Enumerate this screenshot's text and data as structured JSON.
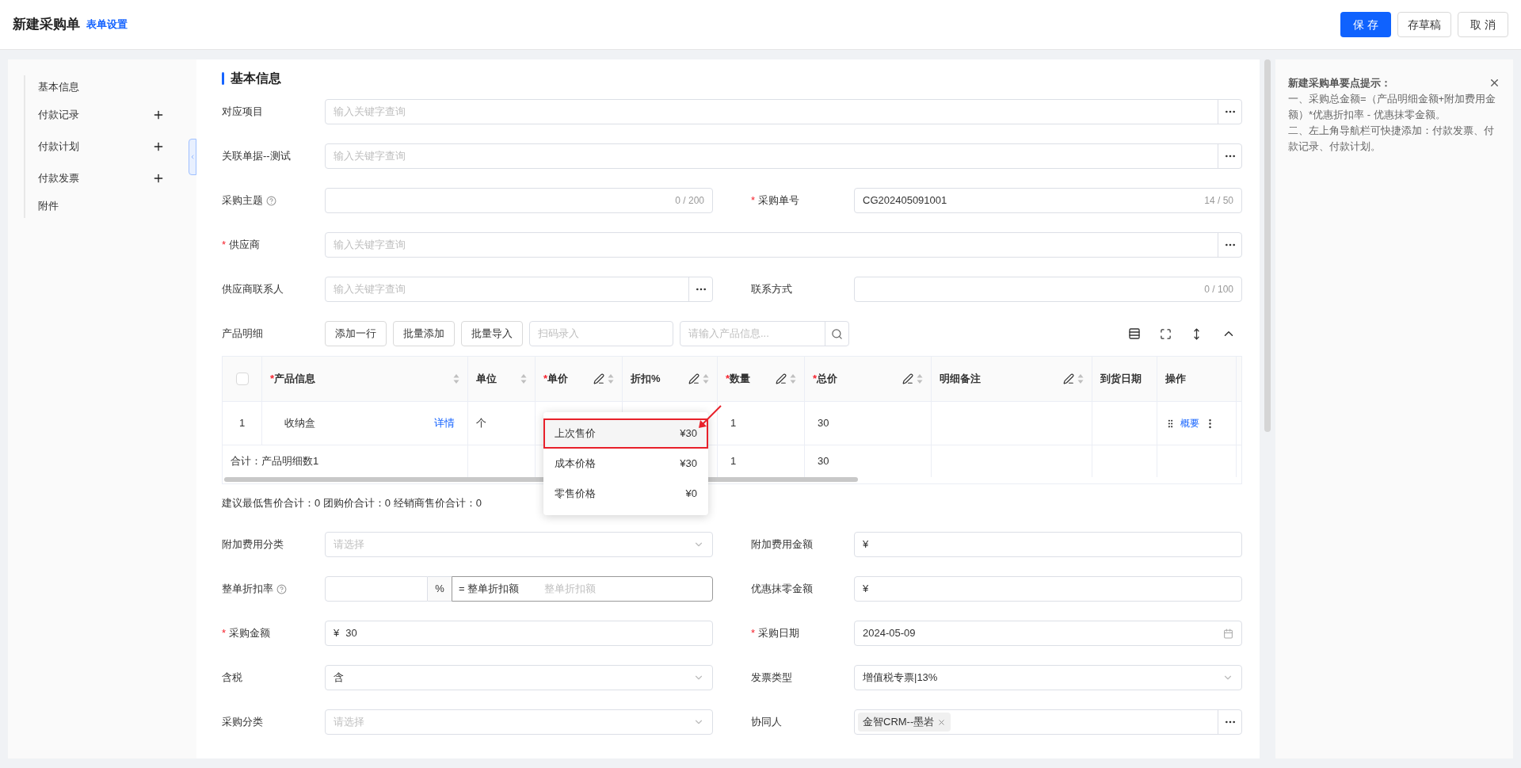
{
  "header": {
    "title": "新建采购单",
    "settings_link": "表单设置",
    "buttons": [
      {
        "label": "保 存",
        "kind": "primary"
      },
      {
        "label": "存草稿",
        "kind": "default"
      },
      {
        "label": "取 消",
        "kind": "default"
      }
    ]
  },
  "nav": {
    "items": [
      {
        "label": "基本信息",
        "addable": false
      },
      {
        "label": "付款记录",
        "addable": true
      },
      {
        "label": "付款计划",
        "addable": true
      },
      {
        "label": "付款发票",
        "addable": true
      },
      {
        "label": "附件",
        "addable": false
      }
    ]
  },
  "required_mark": "*",
  "section_title": "基本信息",
  "top_rows": [
    [
      {
        "label": "对应项目",
        "required": false,
        "help": false,
        "kind": "lookup",
        "placeholder": "输入关键字查询"
      }
    ],
    [
      {
        "label": "关联单据--测试",
        "required": false,
        "help": false,
        "kind": "lookup",
        "placeholder": "输入关键字查询"
      }
    ],
    [
      {
        "label": "采购主题",
        "required": false,
        "help": true,
        "kind": "text",
        "counter": "0 / 200"
      },
      {
        "label": "采购单号",
        "required": true,
        "help": false,
        "kind": "text",
        "value": "CG202405091001",
        "counter": "14 / 50"
      }
    ],
    [
      {
        "label": "供应商",
        "required": true,
        "help": false,
        "kind": "lookup",
        "placeholder": "输入关键字查询"
      }
    ],
    [
      {
        "label": "供应商联系人",
        "required": false,
        "help": false,
        "kind": "lookup",
        "placeholder": "输入关键字查询"
      },
      {
        "label": "联系方式",
        "required": false,
        "help": false,
        "kind": "text",
        "counter": "0 / 100"
      }
    ]
  ],
  "products": {
    "label": "产品明细",
    "buttons": [
      "添加一行",
      "批量添加",
      "批量导入"
    ],
    "scan_placeholder": "扫码录入",
    "search_placeholder": "请输入产品信息...",
    "table": {
      "select_all_checked": false,
      "columns": [
        {
          "label": "产品信息",
          "required": true,
          "editable": false,
          "sortable": true
        },
        {
          "label": "单位",
          "required": false,
          "editable": false,
          "sortable": true
        },
        {
          "label": "单价",
          "required": true,
          "editable": true,
          "sortable": true
        },
        {
          "label": "折扣%",
          "required": false,
          "editable": true,
          "sortable": true
        },
        {
          "label": "数量",
          "required": true,
          "editable": true,
          "sortable": true
        },
        {
          "label": "总价",
          "required": true,
          "editable": true,
          "sortable": true
        },
        {
          "label": "明细备注",
          "required": false,
          "editable": true,
          "sortable": true
        },
        {
          "label": "到货日期",
          "required": false,
          "editable": false,
          "sortable": false
        },
        {
          "label": "操作",
          "required": false,
          "editable": false,
          "sortable": false
        }
      ],
      "rows": [
        {
          "index": "1",
          "product": "收纳盒",
          "detail_link": "详情",
          "unit": "个",
          "quantity": "1",
          "total": "30",
          "action_link": "概要"
        }
      ],
      "total_row": {
        "label": "合计：产品明细数1",
        "quantity": "1",
        "total": "30"
      }
    },
    "price_popup": [
      {
        "label": "上次售价",
        "price": "¥30",
        "selected": true
      },
      {
        "label": "成本价格",
        "price": "¥30",
        "selected": false
      },
      {
        "label": "零售价格",
        "price": "¥0",
        "selected": false
      }
    ],
    "summary": "建议最低售价合计：0 团购价合计：0 经销商售价合计：0"
  },
  "bottom_rows": [
    [
      {
        "label": "附加费用分类",
        "required": false,
        "help": false,
        "kind": "select",
        "placeholder": "请选择"
      },
      {
        "label": "附加费用金额",
        "required": false,
        "help": false,
        "kind": "money",
        "prefix": "¥"
      }
    ],
    [
      {
        "label": "整单折扣率",
        "required": false,
        "help": true,
        "kind": "discount",
        "addon": "%",
        "equals_label": "= 整单折扣额",
        "placeholder": "整单折扣额"
      },
      {
        "label": "优惠抹零金额",
        "required": false,
        "help": false,
        "kind": "money",
        "prefix": "¥"
      }
    ],
    [
      {
        "label": "采购金额",
        "required": true,
        "help": false,
        "kind": "money",
        "prefix": "¥",
        "value": "30"
      },
      {
        "label": "采购日期",
        "required": true,
        "help": false,
        "kind": "date",
        "value": "2024-05-09"
      }
    ],
    [
      {
        "label": "含税",
        "required": false,
        "help": false,
        "kind": "select",
        "value": "含"
      },
      {
        "label": "发票类型",
        "required": false,
        "help": false,
        "kind": "select",
        "value": "增值税专票|13%"
      }
    ],
    [
      {
        "label": "采购分类",
        "required": false,
        "help": false,
        "kind": "select",
        "placeholder": "请选择"
      },
      {
        "label": "协同人",
        "required": false,
        "help": false,
        "kind": "tags",
        "tags": [
          "金智CRM--墨岩"
        ]
      }
    ]
  ],
  "tips": {
    "title": "新建采购单要点提示：",
    "lines": [
      "一、采购总金额=（产品明细金额+附加费用金额）*优惠折扣率 - 优惠抹零金额。",
      "二、左上角导航栏可快捷添加：付款发票、付款记录、付款计划。"
    ]
  }
}
